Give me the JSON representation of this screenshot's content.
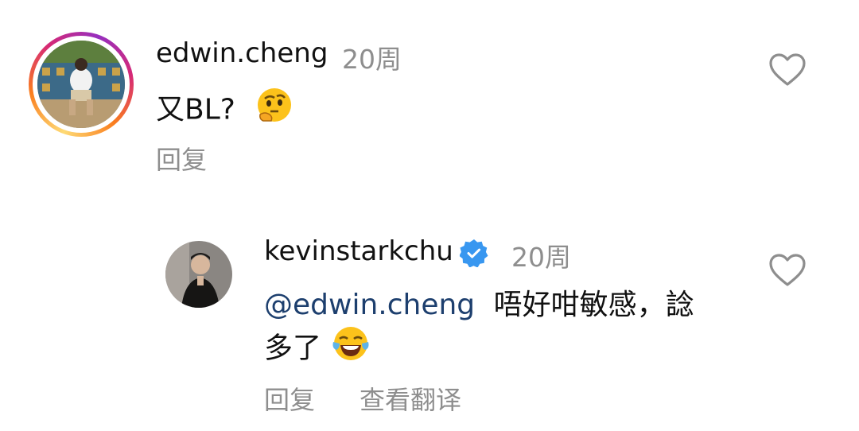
{
  "comments": [
    {
      "username": "edwin.cheng",
      "time": "20周",
      "text": "又BL?",
      "emoji": "thinking-face",
      "reply_label": "回复",
      "has_story_ring": true
    },
    {
      "username": "kevinstarkchu",
      "verified": true,
      "time": "20周",
      "mention": "@edwin.cheng",
      "text_line1": "唔好咁敏感，諗",
      "text_line2": "多了",
      "emoji": "face-with-tears-of-joy",
      "reply_label": "回复",
      "translate_label": "查看翻译"
    }
  ],
  "colors": {
    "secondary_text": "#8e8e8e",
    "mention": "#1d3f6e",
    "verified_blue": "#3897f0"
  }
}
